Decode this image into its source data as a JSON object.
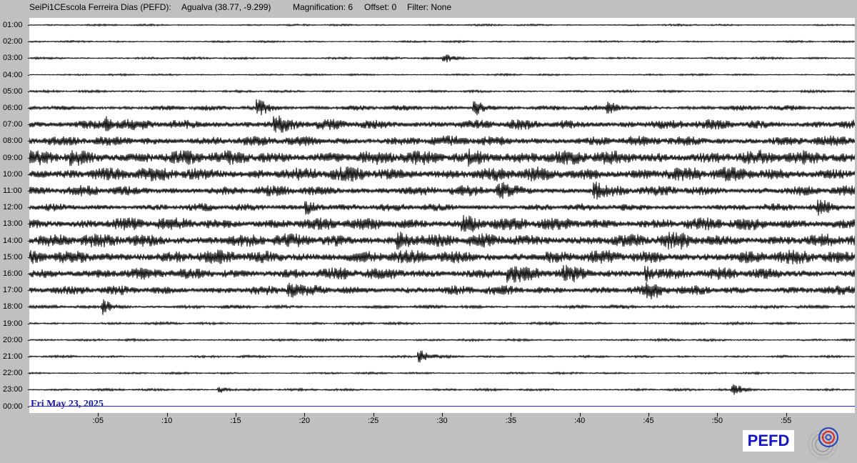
{
  "header": {
    "station": "SeiPi1CEscola Ferreira Dias (PEFD):",
    "location": "Agualva (38.77, -9.299)",
    "magnification": "Magnification: 6",
    "offset": "Offset: 0",
    "filter": "Filter: None"
  },
  "chart_data": {
    "type": "seismogram",
    "date_label": "Fri May 23, 2025",
    "hour_labels": [
      "01:00",
      "02:00",
      "03:00",
      "04:00",
      "05:00",
      "06:00",
      "07:00",
      "08:00",
      "09:00",
      "10:00",
      "11:00",
      "12:00",
      "13:00",
      "14:00",
      "15:00",
      "16:00",
      "17:00",
      "18:00",
      "19:00",
      "20:00",
      "21:00",
      "22:00",
      "23:00",
      "00:00"
    ],
    "minute_labels": [
      ":05",
      ":10",
      ":15",
      ":20",
      ":25",
      ":30",
      ":35",
      ":40",
      ":45",
      ":50",
      ":55"
    ],
    "minute_values": [
      5,
      10,
      15,
      20,
      25,
      30,
      35,
      40,
      45,
      50,
      55
    ],
    "x_range_minutes": [
      0,
      60
    ],
    "hourly_noise_level": [
      0.05,
      0.05,
      0.08,
      0.05,
      0.08,
      0.25,
      0.55,
      0.55,
      0.8,
      0.8,
      0.55,
      0.4,
      0.7,
      0.75,
      0.75,
      0.65,
      0.5,
      0.15,
      0.1,
      0.08,
      0.08,
      0.06,
      0.08,
      0.0
    ],
    "events": [
      {
        "hour": 3,
        "minute": 30.3,
        "amplitude": 0.5
      },
      {
        "hour": 6,
        "minute": 16.8,
        "amplitude": 0.9
      },
      {
        "hour": 6,
        "minute": 32.5,
        "amplitude": 0.8
      },
      {
        "hour": 6,
        "minute": 42.2,
        "amplitude": 0.6
      },
      {
        "hour": 7,
        "minute": 18.0,
        "amplitude": 0.8
      },
      {
        "hour": 7,
        "minute": 5.8,
        "amplitude": 0.6
      },
      {
        "hour": 9,
        "minute": 32.2,
        "amplitude": 1.0
      },
      {
        "hour": 9,
        "minute": 3.2,
        "amplitude": 0.9
      },
      {
        "hour": 11,
        "minute": 34.2,
        "amplitude": 0.8
      },
      {
        "hour": 11,
        "minute": 41.2,
        "amplitude": 0.7
      },
      {
        "hour": 12,
        "minute": 20.3,
        "amplitude": 0.7
      },
      {
        "hour": 12,
        "minute": 57.5,
        "amplitude": 0.9
      },
      {
        "hour": 13,
        "minute": 31.7,
        "amplitude": 1.0
      },
      {
        "hour": 14,
        "minute": 27.0,
        "amplitude": 0.9
      },
      {
        "hour": 14,
        "minute": 46.7,
        "amplitude": 0.9
      },
      {
        "hour": 16,
        "minute": 39.0,
        "amplitude": 1.0
      },
      {
        "hour": 16,
        "minute": 35.0,
        "amplitude": 0.9
      },
      {
        "hour": 16,
        "minute": 45.0,
        "amplitude": 0.7
      },
      {
        "hour": 17,
        "minute": 45.1,
        "amplitude": 1.0
      },
      {
        "hour": 17,
        "minute": 19.0,
        "amplitude": 0.7
      },
      {
        "hour": 18,
        "minute": 5.5,
        "amplitude": 0.8
      },
      {
        "hour": 21,
        "minute": 28.5,
        "amplitude": 0.7
      },
      {
        "hour": 23,
        "minute": 51.3,
        "amplitude": 0.6
      },
      {
        "hour": 23,
        "minute": 14.0,
        "amplitude": 0.3
      }
    ],
    "trace_color": "#000000",
    "current_time_line_color": "#1a1aa8"
  },
  "logo": {
    "text": "PEFD",
    "text_color": "#1414c8",
    "mark_colors": [
      "#2040c0",
      "#e02020",
      "#808080"
    ]
  }
}
